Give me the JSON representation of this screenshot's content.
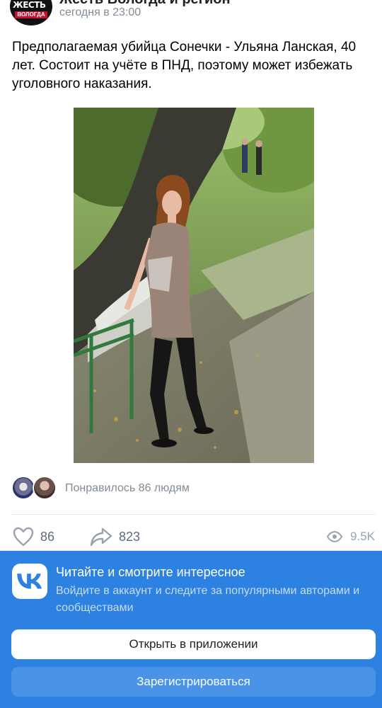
{
  "post": {
    "group_name": "Жесть Вологда и регион",
    "avatar_text_top": "ЖЕСТЬ",
    "avatar_text_bottom": "ВОЛОГДА",
    "time": "сегодня в 23:00",
    "text": "Предполагаемая убийца Сонечки - Ульяна Ланская, 40 лет. Состоит на учёте в ПНД, поэтому может избежать уголовного наказания.",
    "photo_icon": "woman-in-park-photo"
  },
  "likes": {
    "text": "Понравилось 86 людям"
  },
  "actions": {
    "likes_count": "86",
    "shares_count": "823",
    "views_count": "9.5K"
  },
  "banner": {
    "title": "Читайте и смотрите интересное",
    "subtitle": "Войдите в аккаунт и следите за популярными авторами и сообществами",
    "open_button": "Открыть в приложении",
    "register_button": "Зарегистрироваться",
    "accent_color": "#2d81e0"
  }
}
